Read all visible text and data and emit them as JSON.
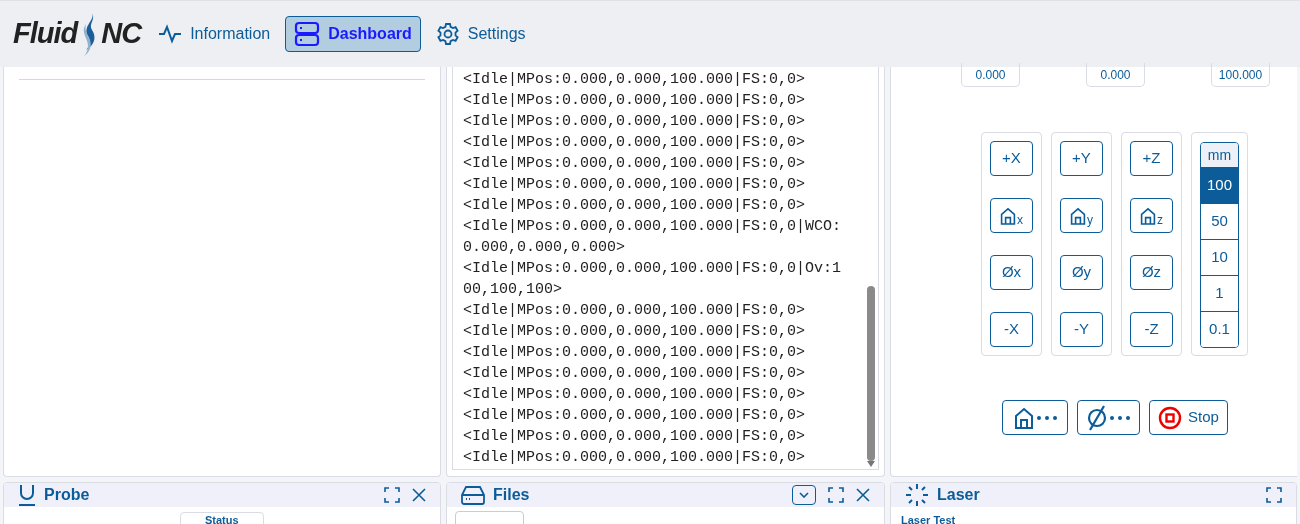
{
  "brand": {
    "left": "Fluid",
    "right": "NC"
  },
  "nav": [
    {
      "label": "Information",
      "selected": false
    },
    {
      "label": "Dashboard",
      "selected": true
    },
    {
      "label": "Settings",
      "selected": false
    }
  ],
  "console": {
    "lines": [
      "<Idle|MPos:0.000,0.000,100.000|FS:0,0>",
      "<Idle|MPos:0.000,0.000,100.000|FS:0,0>",
      "<Idle|MPos:0.000,0.000,100.000|FS:0,0>",
      "<Idle|MPos:0.000,0.000,100.000|FS:0,0>",
      "<Idle|MPos:0.000,0.000,100.000|FS:0,0>",
      "<Idle|MPos:0.000,0.000,100.000|FS:0,0>",
      "<Idle|MPos:0.000,0.000,100.000|FS:0,0>",
      "<Idle|MPos:0.000,0.000,100.000|FS:0,0|WCO:0.000,0.000,0.000>",
      "<Idle|MPos:0.000,0.000,100.000|FS:0,0|Ov:100,100,100>",
      "<Idle|MPos:0.000,0.000,100.000|FS:0,0>",
      "<Idle|MPos:0.000,0.000,100.000|FS:0,0>",
      "<Idle|MPos:0.000,0.000,100.000|FS:0,0>",
      "<Idle|MPos:0.000,0.000,100.000|FS:0,0>",
      "<Idle|MPos:0.000,0.000,100.000|FS:0,0>",
      "<Idle|MPos:0.000,0.000,100.000|FS:0,0>",
      "<Idle|MPos:0.000,0.000,100.000|FS:0,0>",
      "<Idle|MPos:0.000,0.000,100.000|FS:0,0>"
    ]
  },
  "positions": [
    "0.000",
    "0.000",
    "100.000"
  ],
  "jog_columns": [
    {
      "plus": "+X",
      "home": "x",
      "zero": "Øx",
      "minus": "-X"
    },
    {
      "plus": "+Y",
      "home": "y",
      "zero": "Øy",
      "minus": "-Y"
    },
    {
      "plus": "+Z",
      "home": "z",
      "zero": "Øz",
      "minus": "-Z"
    }
  ],
  "steps": {
    "unit": "mm",
    "items": [
      {
        "label": "100",
        "selected": true
      },
      {
        "label": "50",
        "selected": false
      },
      {
        "label": "10",
        "selected": false
      },
      {
        "label": "1",
        "selected": false
      },
      {
        "label": "0.1",
        "selected": false
      }
    ]
  },
  "actions": [
    {
      "kind": "home_all"
    },
    {
      "kind": "zero_all"
    },
    {
      "kind": "stop",
      "label": "Stop"
    }
  ],
  "panels": [
    {
      "title": "Probe",
      "content": "Status"
    },
    {
      "title": "Files"
    },
    {
      "title": "Laser",
      "content": "Laser Test"
    }
  ]
}
